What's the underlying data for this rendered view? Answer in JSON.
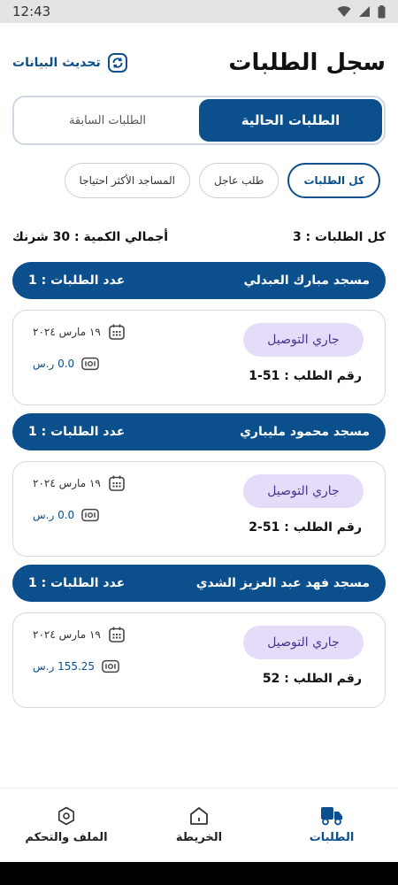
{
  "status_bar": {
    "time": "12:43"
  },
  "header": {
    "title": "سجل الطلبات",
    "refresh_label": "تحديث البيانات"
  },
  "tabs": [
    {
      "label": "الطلبات الحالية",
      "active": true
    },
    {
      "label": "الطلبات السابقة",
      "active": false
    }
  ],
  "filters": [
    {
      "label": "كل الطلبات",
      "selected": true
    },
    {
      "label": "طلب عاجل",
      "selected": false
    },
    {
      "label": "المساجد الأكثر احتياجا",
      "selected": false
    }
  ],
  "summary": {
    "total_orders": "كل الطلبات : 3",
    "total_quantity": "أجمالي الكمية : 30 شرنك"
  },
  "groups": [
    {
      "mosque": "مسجد مبارك العبدلي",
      "count": "عدد الطلبات : 1",
      "order": {
        "status": "جاري التوصيل",
        "number": "رقم الطلب : 51-1",
        "date": "١٩ مارس ٢٠٢٤",
        "price": "0.0 ر.س"
      }
    },
    {
      "mosque": "مسجد محمود مليباري",
      "count": "عدد الطلبات : 1",
      "order": {
        "status": "جاري التوصيل",
        "number": "رقم الطلب : 51-2",
        "date": "١٩ مارس ٢٠٢٤",
        "price": "0.0 ر.س"
      }
    },
    {
      "mosque": "مسجد فهد عبد العزيز الشدي",
      "count": "عدد الطلبات : 1",
      "order": {
        "status": "جاري التوصيل",
        "number": "رقم الطلب : 52",
        "date": "١٩ مارس ٢٠٢٤",
        "price": "155.25 ر.س"
      }
    }
  ],
  "bottom_nav": [
    {
      "label": "الطلبات",
      "icon": "truck-icon",
      "active": true
    },
    {
      "label": "الخريطة",
      "icon": "home-icon",
      "active": false
    },
    {
      "label": "الملف والتحكم",
      "icon": "gear-icon",
      "active": false
    }
  ],
  "colors": {
    "primary": "#0b4f8c",
    "status_pill_bg": "#e4dcf8",
    "status_pill_text": "#4a3290"
  }
}
